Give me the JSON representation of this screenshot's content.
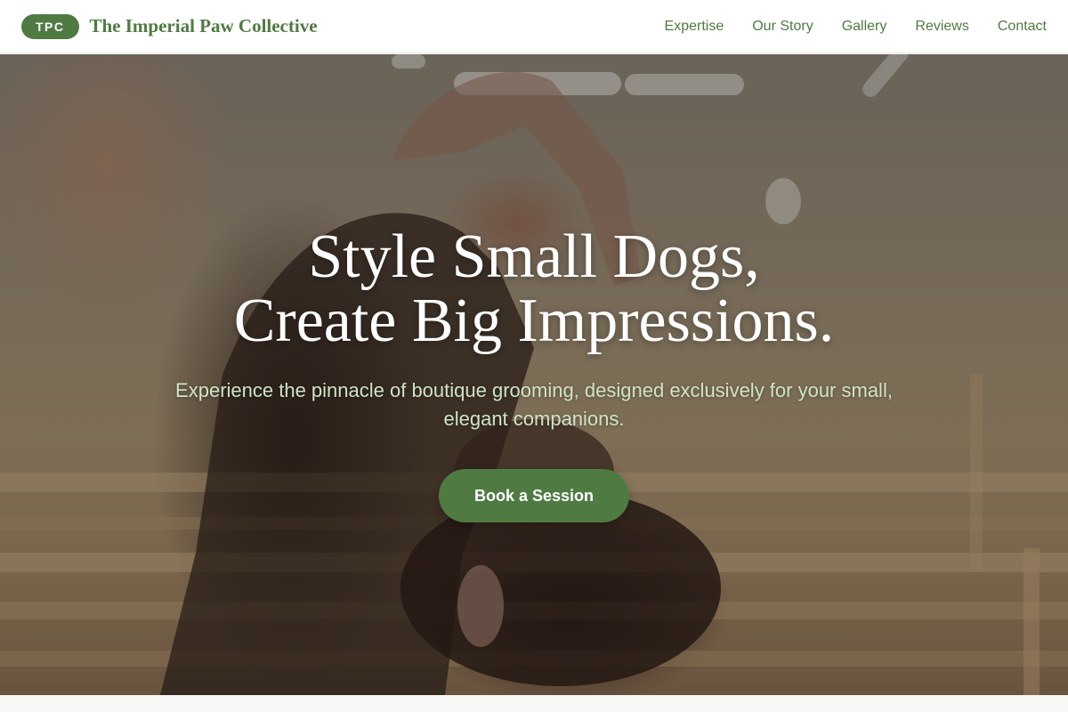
{
  "brand": {
    "badge": "TPC",
    "name": "The Imperial Paw Collective"
  },
  "nav": {
    "items": [
      {
        "label": "Expertise"
      },
      {
        "label": "Our Story"
      },
      {
        "label": "Gallery"
      },
      {
        "label": "Reviews"
      },
      {
        "label": "Contact"
      }
    ]
  },
  "hero": {
    "title_line1": "Style Small Dogs,",
    "title_line2": "Create Big Impressions.",
    "subtitle": "Experience the pinnacle of boutique grooming, designed exclusively for your small, elegant companions.",
    "cta_label": "Book a Session",
    "image_description": "groomer-trimming-small-dog-photo"
  },
  "colors": {
    "brand_green": "#4f7b43",
    "subtitle_green": "#cfe3c6",
    "header_bg": "#ffffff"
  }
}
